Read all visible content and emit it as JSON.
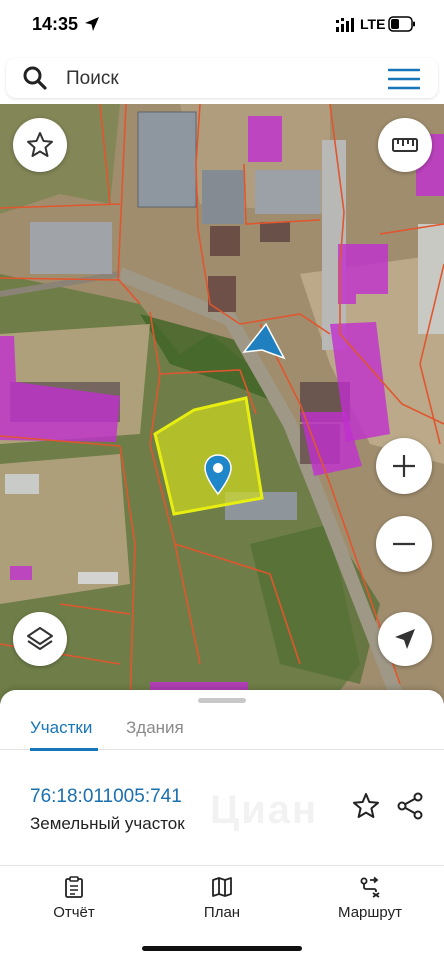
{
  "status_bar": {
    "time": "14:35",
    "network": "LTE",
    "icons": [
      "location-arrow-icon",
      "signal-icon",
      "battery-icon"
    ]
  },
  "search": {
    "placeholder": "Поиск",
    "icons": [
      "search-icon",
      "menu-icon"
    ]
  },
  "map": {
    "controls": [
      "favorite-star-icon",
      "ruler-icon",
      "zoom-in-icon",
      "zoom-out-icon",
      "layers-icon",
      "my-location-icon"
    ],
    "markers": [
      "location-pin-icon",
      "direction-arrow-icon"
    ],
    "colors": {
      "parcel_border": "#e0562e",
      "selected_parcel": "#d6e01a",
      "building_overlay": "#c02fd0",
      "accent": "#1776b8"
    }
  },
  "sheet": {
    "tabs": [
      {
        "label": "Участки",
        "active": true
      },
      {
        "label": "Здания",
        "active": false
      }
    ],
    "parcel": {
      "cadastral_number": "76:18:011005:741",
      "type": "Земельный участок"
    },
    "watermark": "Циан"
  },
  "bottom_nav": {
    "items": [
      {
        "label": "Отчёт",
        "icon": "report-icon"
      },
      {
        "label": "План",
        "icon": "map-plan-icon"
      },
      {
        "label": "Маршрут",
        "icon": "route-icon"
      }
    ]
  }
}
